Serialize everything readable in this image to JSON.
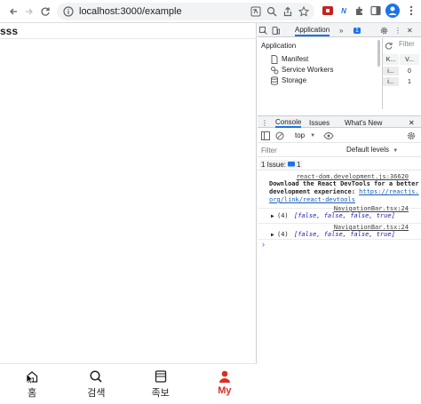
{
  "browser": {
    "url": "localhost:3000/example",
    "back_icon": "arrow-left",
    "forward_icon": "arrow-right",
    "reload_icon": "reload"
  },
  "page": {
    "header_text": "sss",
    "bottom_nav": [
      {
        "label": "홈",
        "icon": "home-icon",
        "active": false
      },
      {
        "label": "검색",
        "icon": "search-icon",
        "active": false
      },
      {
        "label": "족보",
        "icon": "book-icon",
        "active": false
      },
      {
        "label": "My",
        "icon": "user-icon",
        "active": true
      }
    ],
    "active_color": "#d93025"
  },
  "devtools": {
    "tabs": {
      "application": "Application",
      "more": "»",
      "badge_count": "1"
    },
    "app_panel": {
      "title": "Application",
      "items": [
        "Manifest",
        "Service Workers",
        "Storage"
      ]
    },
    "mini": {
      "filter": "Filter",
      "col1": "K...",
      "col2": "V...",
      "row1": [
        "i...",
        "0"
      ],
      "row2": [
        "i...",
        "1"
      ]
    },
    "console_tabs": {
      "console": "Console",
      "issues": "Issues",
      "whats_new": "What's New"
    },
    "toolbar": {
      "context": "top"
    },
    "filter_placeholder": "Filter",
    "levels": "Default levels",
    "issues_label": "1 Issue:",
    "issues_count": "1",
    "logs": [
      {
        "source": "react-dom.development.js:36620",
        "line1": "Download the React DevTools for a better",
        "line2a": "development experience: ",
        "link": "https://reactjs.",
        "line3": "org/link/react-devtools"
      },
      {
        "source": "NavigationBar.tsx:24",
        "count": "(4)",
        "value": "[false, false, false, true]"
      },
      {
        "source": "NavigationBar.tsx:24",
        "count": "(4)",
        "value": "[false, false, false, true]"
      }
    ]
  }
}
